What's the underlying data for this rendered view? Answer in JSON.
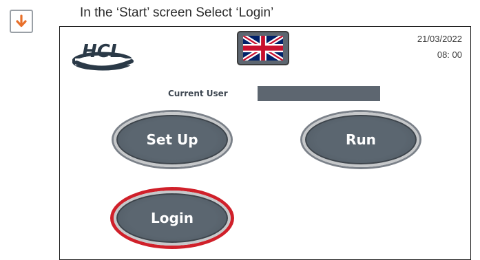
{
  "instruction": {
    "text": "In the ‘Start’ screen Select ‘Login’",
    "icon": "arrow-down-icon",
    "icon_color": "#e8702a"
  },
  "screen": {
    "logo_text": "HCL",
    "language_flag": "uk-flag-icon",
    "date": "21/03/2022",
    "time": "08: 00",
    "current_user_label": "Current User",
    "current_user_value": "",
    "buttons": {
      "setup": "Set Up",
      "run": "Run",
      "login": "Login"
    },
    "highlight_color": "#d0202a",
    "button_color": "#5b6670"
  }
}
